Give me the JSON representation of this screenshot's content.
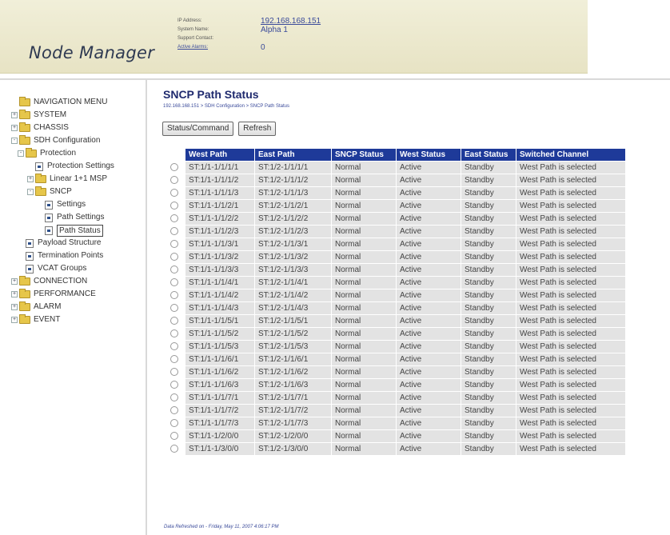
{
  "app": {
    "title": "Node Manager"
  },
  "header": {
    "ip_label": "IP Address:",
    "ip_value": "192.168.168.151",
    "system_name_label": "System Name:",
    "system_name_value": "Alpha 1",
    "support_contact_label": "Support Contact:",
    "support_contact_value": "",
    "active_alarms_label": "Active Alarms:",
    "active_alarms_value": "0"
  },
  "nav": {
    "items": [
      {
        "label": "NAVIGATION MENU",
        "indent": 0,
        "toggle": "",
        "icon": "folder-open-icon"
      },
      {
        "label": "SYSTEM",
        "indent": 0,
        "toggle": "+",
        "icon": "folder-icon"
      },
      {
        "label": "CHASSIS",
        "indent": 0,
        "toggle": "+",
        "icon": "folder-icon"
      },
      {
        "label": "SDH Configuration",
        "indent": 0,
        "toggle": "-",
        "icon": "folder-open-icon"
      },
      {
        "label": "Protection",
        "indent": 1,
        "toggle": "-",
        "icon": "folder-open-icon"
      },
      {
        "label": "Protection Settings",
        "indent": 2,
        "toggle": "",
        "icon": "page-icon"
      },
      {
        "label": "Linear 1+1 MSP",
        "indent": 2,
        "toggle": "+",
        "icon": "folder-icon"
      },
      {
        "label": "SNCP",
        "indent": 2,
        "toggle": "-",
        "icon": "folder-open-icon"
      },
      {
        "label": "Settings",
        "indent": 3,
        "toggle": "",
        "icon": "page-icon"
      },
      {
        "label": "Path Settings",
        "indent": 3,
        "toggle": "",
        "icon": "page-icon"
      },
      {
        "label": "Path Status",
        "indent": 3,
        "toggle": "",
        "icon": "page-icon",
        "selected": true
      },
      {
        "label": "Payload Structure",
        "indent": 1,
        "toggle": "",
        "icon": "page-icon"
      },
      {
        "label": "Termination Points",
        "indent": 1,
        "toggle": "",
        "icon": "page-icon"
      },
      {
        "label": "VCAT Groups",
        "indent": 1,
        "toggle": "",
        "icon": "page-icon"
      },
      {
        "label": "CONNECTION",
        "indent": 0,
        "toggle": "+",
        "icon": "folder-icon"
      },
      {
        "label": "PERFORMANCE",
        "indent": 0,
        "toggle": "+",
        "icon": "folder-icon"
      },
      {
        "label": "ALARM",
        "indent": 0,
        "toggle": "+",
        "icon": "folder-icon"
      },
      {
        "label": "EVENT",
        "indent": 0,
        "toggle": "+",
        "icon": "folder-icon"
      }
    ]
  },
  "main": {
    "title": "SNCP Path Status",
    "breadcrumb": "192.168.168.151 > SDH Configuration > SNCP Path Status",
    "status_command_label": "Status/Command",
    "refresh_label": "Refresh",
    "columns": [
      "West Path",
      "East Path",
      "SNCP Status",
      "West Status",
      "East Status",
      "Switched Channel"
    ],
    "rows": [
      [
        "ST:1/1-1/1/1/1",
        "ST:1/2-1/1/1/1",
        "Normal",
        "Active",
        "Standby",
        "West Path is selected"
      ],
      [
        "ST:1/1-1/1/1/2",
        "ST:1/2-1/1/1/2",
        "Normal",
        "Active",
        "Standby",
        "West Path is selected"
      ],
      [
        "ST:1/1-1/1/1/3",
        "ST:1/2-1/1/1/3",
        "Normal",
        "Active",
        "Standby",
        "West Path is selected"
      ],
      [
        "ST:1/1-1/1/2/1",
        "ST:1/2-1/1/2/1",
        "Normal",
        "Active",
        "Standby",
        "West Path is selected"
      ],
      [
        "ST:1/1-1/1/2/2",
        "ST:1/2-1/1/2/2",
        "Normal",
        "Active",
        "Standby",
        "West Path is selected"
      ],
      [
        "ST:1/1-1/1/2/3",
        "ST:1/2-1/1/2/3",
        "Normal",
        "Active",
        "Standby",
        "West Path is selected"
      ],
      [
        "ST:1/1-1/1/3/1",
        "ST:1/2-1/1/3/1",
        "Normal",
        "Active",
        "Standby",
        "West Path is selected"
      ],
      [
        "ST:1/1-1/1/3/2",
        "ST:1/2-1/1/3/2",
        "Normal",
        "Active",
        "Standby",
        "West Path is selected"
      ],
      [
        "ST:1/1-1/1/3/3",
        "ST:1/2-1/1/3/3",
        "Normal",
        "Active",
        "Standby",
        "West Path is selected"
      ],
      [
        "ST:1/1-1/1/4/1",
        "ST:1/2-1/1/4/1",
        "Normal",
        "Active",
        "Standby",
        "West Path is selected"
      ],
      [
        "ST:1/1-1/1/4/2",
        "ST:1/2-1/1/4/2",
        "Normal",
        "Active",
        "Standby",
        "West Path is selected"
      ],
      [
        "ST:1/1-1/1/4/3",
        "ST:1/2-1/1/4/3",
        "Normal",
        "Active",
        "Standby",
        "West Path is selected"
      ],
      [
        "ST:1/1-1/1/5/1",
        "ST:1/2-1/1/5/1",
        "Normal",
        "Active",
        "Standby",
        "West Path is selected"
      ],
      [
        "ST:1/1-1/1/5/2",
        "ST:1/2-1/1/5/2",
        "Normal",
        "Active",
        "Standby",
        "West Path is selected"
      ],
      [
        "ST:1/1-1/1/5/3",
        "ST:1/2-1/1/5/3",
        "Normal",
        "Active",
        "Standby",
        "West Path is selected"
      ],
      [
        "ST:1/1-1/1/6/1",
        "ST:1/2-1/1/6/1",
        "Normal",
        "Active",
        "Standby",
        "West Path is selected"
      ],
      [
        "ST:1/1-1/1/6/2",
        "ST:1/2-1/1/6/2",
        "Normal",
        "Active",
        "Standby",
        "West Path is selected"
      ],
      [
        "ST:1/1-1/1/6/3",
        "ST:1/2-1/1/6/3",
        "Normal",
        "Active",
        "Standby",
        "West Path is selected"
      ],
      [
        "ST:1/1-1/1/7/1",
        "ST:1/2-1/1/7/1",
        "Normal",
        "Active",
        "Standby",
        "West Path is selected"
      ],
      [
        "ST:1/1-1/1/7/2",
        "ST:1/2-1/1/7/2",
        "Normal",
        "Active",
        "Standby",
        "West Path is selected"
      ],
      [
        "ST:1/1-1/1/7/3",
        "ST:1/2-1/1/7/3",
        "Normal",
        "Active",
        "Standby",
        "West Path is selected"
      ],
      [
        "ST:1/1-1/2/0/0",
        "ST:1/2-1/2/0/0",
        "Normal",
        "Active",
        "Standby",
        "West Path is selected"
      ],
      [
        "ST:1/1-1/3/0/0",
        "ST:1/2-1/3/0/0",
        "Normal",
        "Active",
        "Standby",
        "West Path is selected"
      ]
    ],
    "refreshed_text": "Data Refreshed on - Friday, May 11, 2007 4:06:17 PM"
  },
  "colors": {
    "header_bg": "#ebe7ca",
    "table_header": "#1e3a99",
    "title": "#1f2a6e",
    "link": "#3a4a9a"
  }
}
